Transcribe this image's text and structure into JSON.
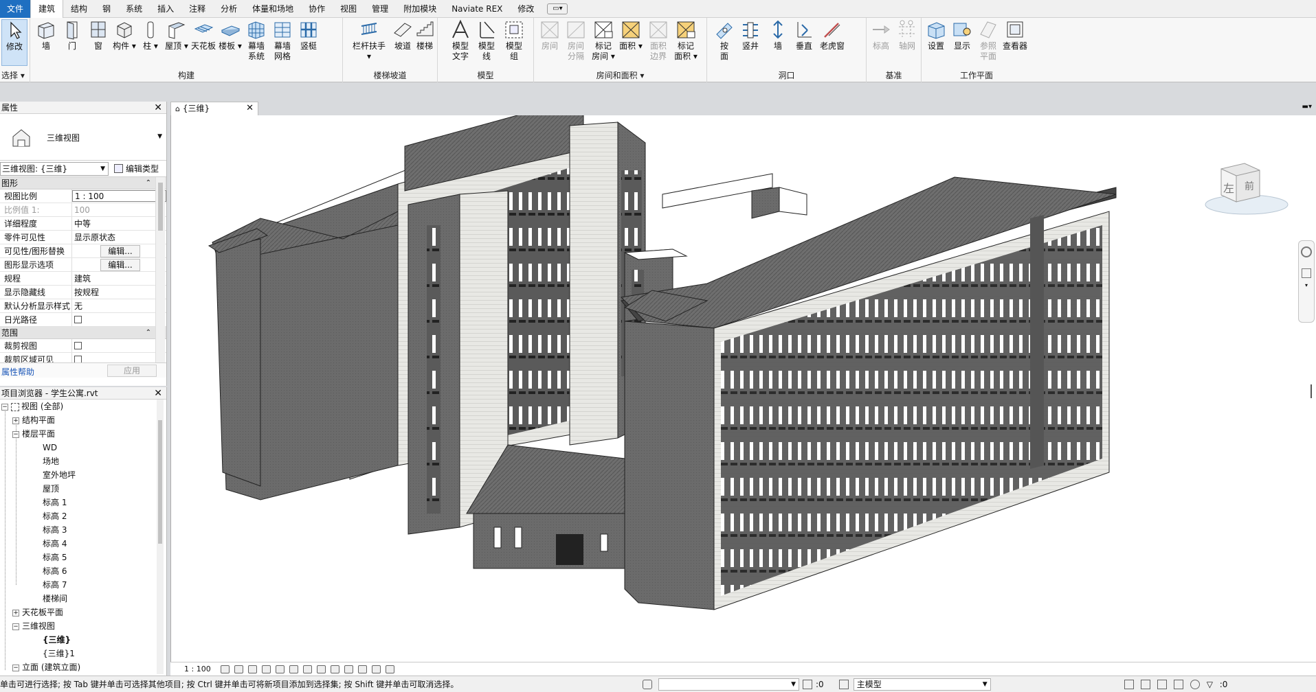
{
  "menubar": {
    "items": [
      "文件",
      "建筑",
      "结构",
      "钢",
      "系统",
      "插入",
      "注释",
      "分析",
      "体量和场地",
      "协作",
      "视图",
      "管理",
      "附加模块",
      "Naviate REX",
      "修改"
    ]
  },
  "ribbon": {
    "select": {
      "modify": "修改",
      "group": "选择"
    },
    "build": {
      "wall": "墙",
      "door": "门",
      "window": "窗",
      "component": "构件",
      "column": "柱",
      "roof": "屋顶",
      "ceiling": "天花板",
      "floor": "楼板",
      "curtain_system_1": "幕墙",
      "curtain_system_2": "系统",
      "curtain_grid_1": "幕墙",
      "curtain_grid_2": "网格",
      "mullion": "竖梃",
      "group": "构建"
    },
    "circulation": {
      "railing": "栏杆扶手",
      "ramp": "坡道",
      "stair": "楼梯",
      "group": "楼梯坡道"
    },
    "model": {
      "text_1": "模型",
      "text_2": "文字",
      "line_1": "模型",
      "line_2": "线",
      "group_1": "模型",
      "group_2": "组",
      "group": "模型"
    },
    "room": {
      "room": "房间",
      "sep_1": "房间",
      "sep_2": "分隔",
      "tag_1": "标记",
      "tag_2": "房间",
      "area": "面积",
      "bound_1": "面积",
      "bound_2": "边界",
      "tagarea_1": "标记",
      "tagarea_2": "面积",
      "group": "房间和面积"
    },
    "opening": {
      "face_1": "按",
      "face_2": "面",
      "shaft": "竖井",
      "wall": "墙",
      "vertical": "垂直",
      "dormer": "老虎窗",
      "group": "洞口"
    },
    "datum": {
      "level": "标高",
      "grid": "轴网",
      "group": "基准"
    },
    "workplane": {
      "set": "设置",
      "show": "显示",
      "ref_1": "参照",
      "ref_2": "平面",
      "viewer": "查看器",
      "group": "工作平面"
    }
  },
  "properties": {
    "title": "属性",
    "type_name": "三维视图",
    "view_selector": "三维视图: {三维}",
    "edit_type": "编辑类型",
    "sections": {
      "graphics": "图形",
      "extents": "范围"
    },
    "rows": [
      {
        "k": "视图比例",
        "v": "1 : 100"
      },
      {
        "k": "比例值 1:",
        "v": "100"
      },
      {
        "k": "详细程度",
        "v": "中等"
      },
      {
        "k": "零件可见性",
        "v": "显示原状态"
      },
      {
        "k": "可见性/图形替换",
        "v": "编辑..."
      },
      {
        "k": "图形显示选项",
        "v": "编辑..."
      },
      {
        "k": "规程",
        "v": "建筑"
      },
      {
        "k": "显示隐藏线",
        "v": "按规程"
      },
      {
        "k": "默认分析显示样式",
        "v": "无"
      },
      {
        "k": "日光路径",
        "v": ""
      }
    ],
    "extent_rows": [
      {
        "k": "裁剪视图",
        "v": ""
      },
      {
        "k": "裁剪区域可见",
        "v": ""
      }
    ],
    "help": "属性帮助",
    "apply": "应用"
  },
  "browser": {
    "title": "项目浏览器 - 学生公寓.rvt",
    "views_all": "视图 (全部)",
    "structural_plans": "结构平面",
    "floor_plans": "楼层平面",
    "floor_items": [
      "WD",
      "场地",
      "室外地坪",
      "屋顶",
      "标高 1",
      "标高 2",
      "标高 3",
      "标高 4",
      "标高 5",
      "标高 6",
      "标高 7",
      "楼梯间"
    ],
    "ceiling_plans": "天花板平面",
    "views_3d": "三维视图",
    "views_3d_items": [
      "{三维}",
      "{三维}1"
    ],
    "elevations": "立面 (建筑立面)"
  },
  "view": {
    "tab_title": "{三维}",
    "scale": "1 : 100",
    "navcube_left": "左",
    "navcube_front": "前"
  },
  "status": {
    "text": "单击可进行选择; 按 Tab 键并单击可选择其他项目; 按 Ctrl 键并单击可将新项目添加到选择集; 按 Shift 键并单击可取消选择。",
    "sel_count": ":0",
    "model": "主模型",
    "filter_count": ":0"
  },
  "colors": {
    "accent": "#1f6fc1",
    "ribbon_bg": "#f7f7f7",
    "panel_bg": "#ffffff"
  }
}
